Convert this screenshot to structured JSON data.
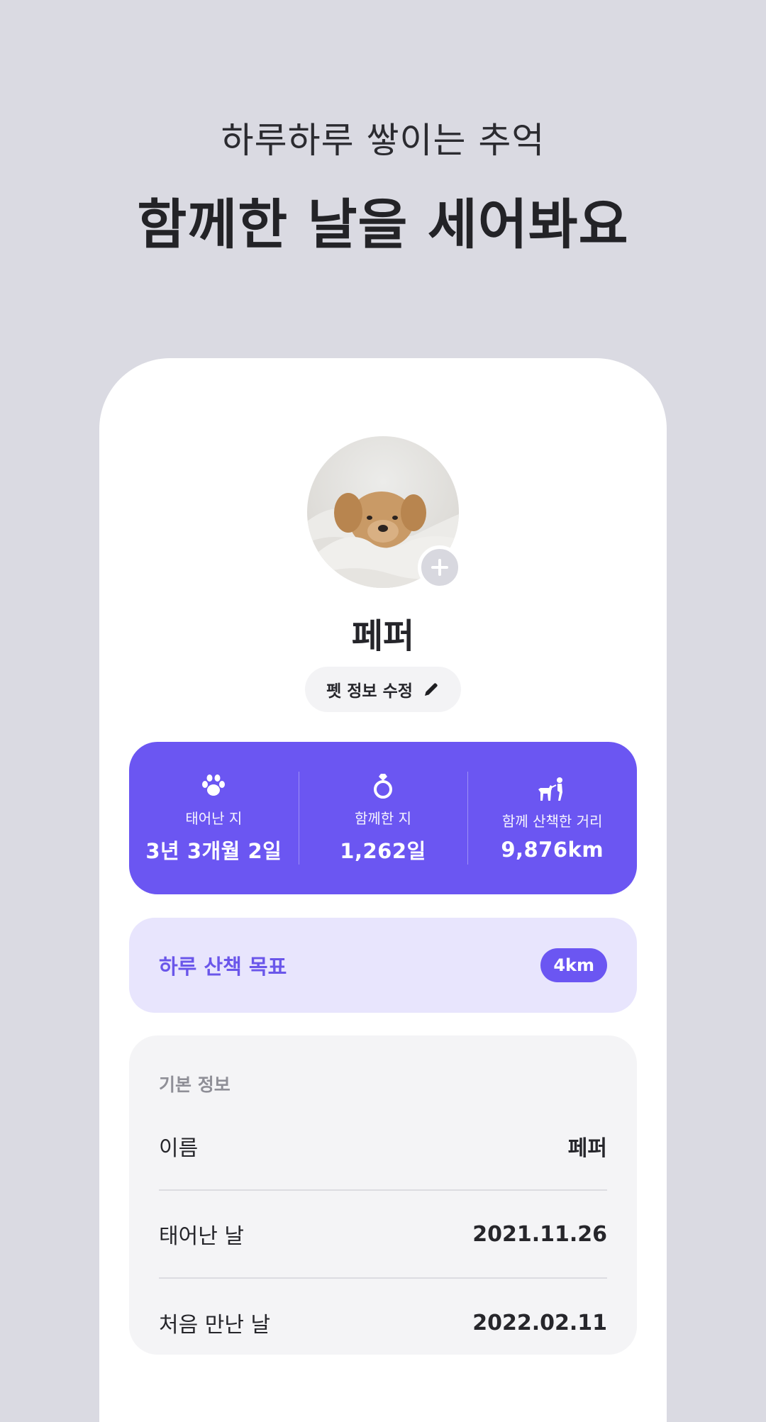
{
  "headline": {
    "subtitle": "하루하루 쌓이는 추억",
    "title": "함께한 날을 세어봐요"
  },
  "profile": {
    "pet_name": "페퍼",
    "edit_label": "펫 정보 수정"
  },
  "stats": [
    {
      "icon": "paw-icon",
      "label": "태어난 지",
      "value": "3년 3개월 2일"
    },
    {
      "icon": "ring-icon",
      "label": "함께한 지",
      "value": "1,262일"
    },
    {
      "icon": "dog-walk-icon",
      "label": "함께 산책한 거리",
      "value": "9,876km"
    }
  ],
  "goal": {
    "label": "하루 산책 목표",
    "value": "4km"
  },
  "basic_info": {
    "heading": "기본 정보",
    "rows": [
      {
        "key": "이름",
        "value": "페퍼"
      },
      {
        "key": "태어난 날",
        "value": "2021.11.26"
      },
      {
        "key": "처음 만난 날",
        "value": "2022.02.11"
      }
    ]
  },
  "colors": {
    "background": "#dadae2",
    "accent": "#6b56f2",
    "accent_light": "#e8e5fd",
    "card": "#f4f4f6"
  }
}
